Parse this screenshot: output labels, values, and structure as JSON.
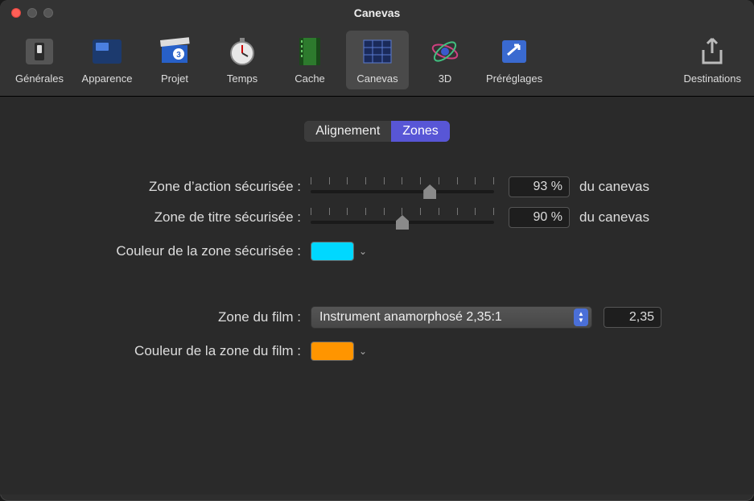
{
  "window_title": "Canevas",
  "tabs": [
    {
      "label": "Générales"
    },
    {
      "label": "Apparence"
    },
    {
      "label": "Projet"
    },
    {
      "label": "Temps"
    },
    {
      "label": "Cache"
    },
    {
      "label": "Canevas",
      "active": true
    },
    {
      "label": "3D"
    },
    {
      "label": "Préréglages"
    },
    {
      "label": "Destinations"
    }
  ],
  "segments": {
    "alignment": "Alignement",
    "zones": "Zones",
    "active": "zones"
  },
  "zones": {
    "action_safe_label": "Zone d’action sécurisée :",
    "action_safe_value": "93 %",
    "action_safe_pct": 93,
    "title_safe_label": "Zone de titre sécurisée :",
    "title_safe_value": "90 %",
    "title_safe_pct": 90,
    "suffix": "du canevas",
    "safe_color_label": "Couleur de la zone sécurisée :",
    "safe_color": "#00d8ff",
    "film_zone_label": "Zone du film :",
    "film_zone_selected": "Instrument anamorphosé 2,35:1",
    "film_zone_ratio": "2,35",
    "film_color_label": "Couleur de la zone du film :",
    "film_color": "#ff9500"
  }
}
